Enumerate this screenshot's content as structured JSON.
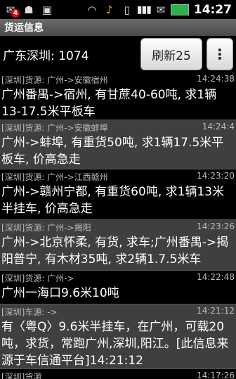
{
  "status_bar": {
    "notification_badge": "4",
    "network_text": "GVıl GVıl",
    "time": "14:27"
  },
  "app_title": "货运信息",
  "header": {
    "region_count": "广东深圳: 1074",
    "refresh_label": "刷新25",
    "menu_label": "⋮"
  },
  "items": [
    {
      "source": "[深圳]货源: 广州->安徽宿州",
      "time": "14:24:38",
      "text": "广州番禺->宿州, 有甘蔗40-60吨, 求1辆13-17.5米平板车"
    },
    {
      "source": "[深圳]货源: 广州->安徽蚌埠",
      "time": "14:24:4",
      "text": "广州->蚌埠, 有重货50吨, 求1辆17.5米平板车, 价高急走"
    },
    {
      "source": "[深圳]货源: 广州->江西赣州",
      "time": "14:23:20",
      "text": "广州->赣州宁都, 有重货60吨, 求1辆13米半挂车, 价高急走"
    },
    {
      "source": "[深圳]货源: 广州->揭阳",
      "time": "14:23:26",
      "text": "广州->北京怀柔, 有货, 求车;广州番禺->揭阳普宁, 有木材35吨, 求2辆1.7.5米车"
    },
    {
      "source": "[深圳]货源: 广州->",
      "time": "14:22:48",
      "text": "广州一海口9.6米10吨"
    },
    {
      "source": "[深圳]车源: ->",
      "time": "14:21:12",
      "text": "有〈粤Q〉9.6米半挂车，在广州，可载20吨，求货，常跑广州,深圳,阳江。[此信息来源于车信通平台]14:21:12"
    },
    {
      "source": "[深圳]货源",
      "time": "14:17:26",
      "text": ""
    }
  ]
}
